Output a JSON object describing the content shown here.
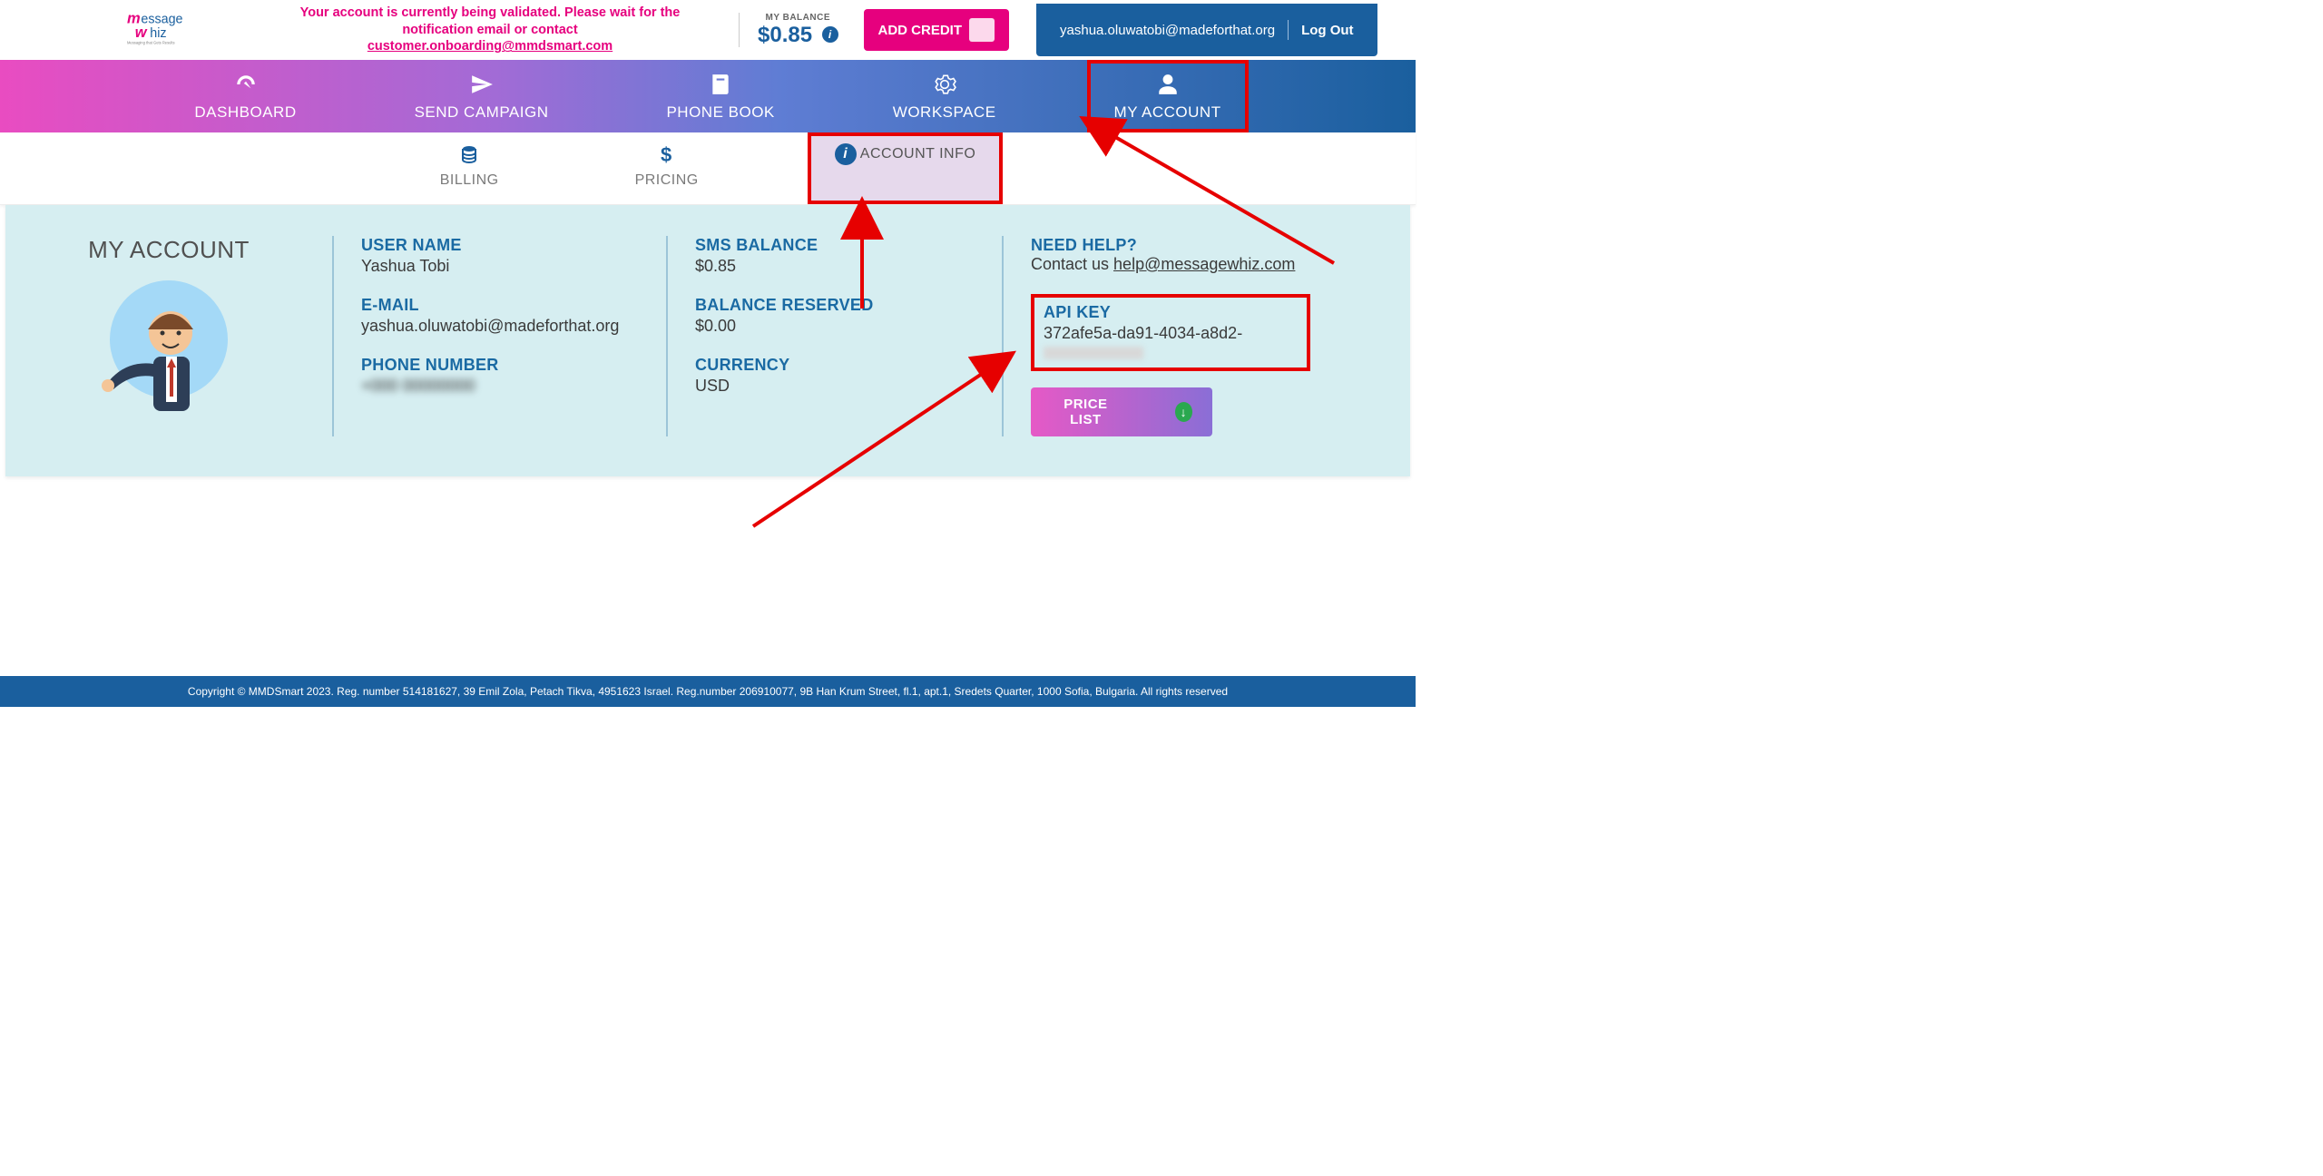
{
  "logo": {
    "text_top": "essage",
    "text_bottom": "hiz",
    "tagline": "Messaging that Gets Results"
  },
  "validation_msg": {
    "line1": "Your account is currently being validated. Please wait for the",
    "line2": "notification email or contact",
    "email": "customer.onboarding@mmdsmart.com"
  },
  "balance": {
    "label": "MY BALANCE",
    "value": "$0.85"
  },
  "add_credit_label": "ADD CREDIT",
  "user_email": "yashua.oluwatobi@madeforthat.org",
  "logout_label": "Log Out",
  "nav": [
    {
      "label": "DASHBOARD"
    },
    {
      "label": "SEND CAMPAIGN"
    },
    {
      "label": "PHONE BOOK"
    },
    {
      "label": "WORKSPACE"
    },
    {
      "label": "MY ACCOUNT"
    }
  ],
  "subnav": [
    {
      "label": "BILLING"
    },
    {
      "label": "PRICING"
    },
    {
      "label": "ACCOUNT INFO"
    }
  ],
  "panel_title": "MY ACCOUNT",
  "account": {
    "user_name": {
      "label": "USER NAME",
      "value": "Yashua Tobi"
    },
    "email": {
      "label": "E-MAIL",
      "value": "yashua.oluwatobi@madeforthat.org"
    },
    "phone": {
      "label": "PHONE NUMBER",
      "value": "+000 00000000"
    },
    "sms_balance": {
      "label": "SMS BALANCE",
      "value": "$0.85"
    },
    "balance_reserved": {
      "label": "BALANCE RESERVED",
      "value": "$0.00"
    },
    "currency": {
      "label": "CURRENCY",
      "value": "USD"
    },
    "need_help": {
      "label": "NEED HELP?",
      "prefix": "Contact us ",
      "link": "help@messagewhiz.com"
    },
    "api_key": {
      "label": "API KEY",
      "value": "372afe5a-da91-4034-a8d2-"
    },
    "price_list_label": "PRICE LIST"
  },
  "footer": "Copyright © MMDSmart 2023. Reg. number 514181627, 39 Emil Zola, Petach Tikva, 4951623 Israel. Reg.number 206910077, 9B Han Krum Street, fl.1, apt.1, Sredets Quarter, 1000 Sofia, Bulgaria. All rights reserved"
}
